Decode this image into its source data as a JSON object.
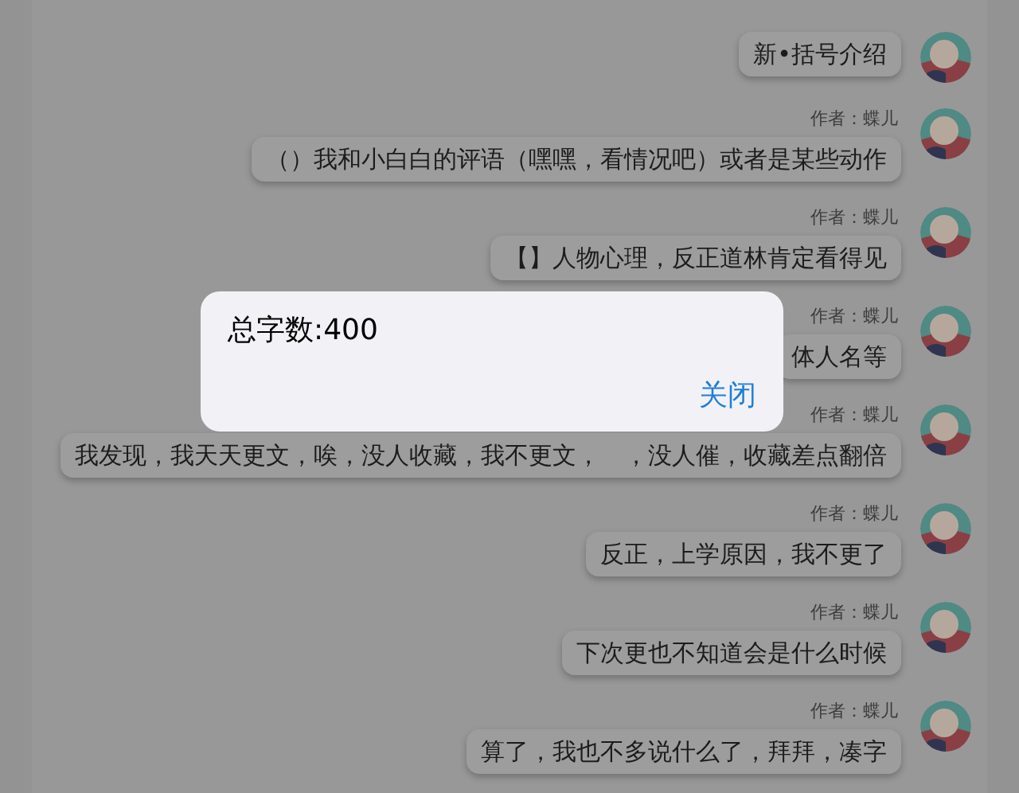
{
  "messages": [
    {
      "text": "新•括号介绍"
    },
    {
      "author": "作者：蝶儿",
      "text": "（）我和小白白的评语（嘿嘿，看情况吧）或者是某些动作"
    },
    {
      "author": "作者：蝶儿",
      "text": "【】人物心理，反正道林肯定看得见"
    },
    {
      "author": "作者：蝶儿",
      "text": "体人名等"
    },
    {
      "author": "作者：蝶儿",
      "text": "我发现，我天天更文，唉，没人收藏，我不更文，　，没人催，收藏差点翻倍"
    },
    {
      "author": "作者：蝶儿",
      "text": "反正，上学原因，我不更了"
    },
    {
      "author": "作者：蝶儿",
      "text": "下次更也不知道会是什么时候"
    },
    {
      "author": "作者：蝶儿",
      "text": "算了，我也不多说什么了，拜拜，凑字"
    }
  ],
  "dialog": {
    "message": "总字数:400",
    "button": "关闭"
  }
}
